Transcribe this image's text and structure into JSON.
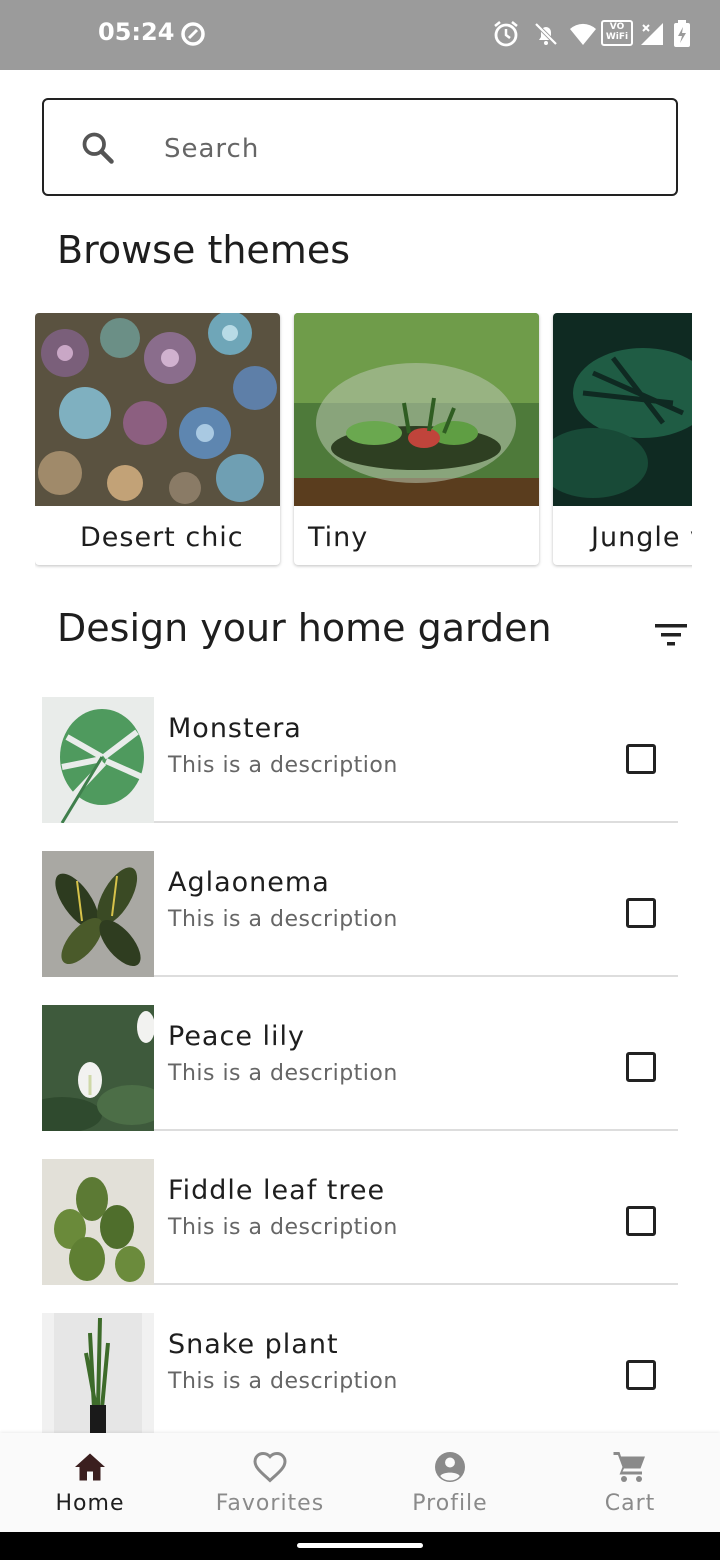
{
  "status_bar": {
    "time": "05:24",
    "icons": [
      "data-saver-icon",
      "alarm-icon",
      "bell-off-icon",
      "wifi-icon",
      "vowifi-icon",
      "signal-icon",
      "battery-charging-icon"
    ],
    "vowifi_text_top": "VO",
    "vowifi_text_bottom": "WiFi"
  },
  "search": {
    "placeholder": "Search",
    "icon": "search-icon"
  },
  "browse": {
    "title": "Browse themes",
    "themes": [
      {
        "label": "Desert chic",
        "icon": "succulents-image"
      },
      {
        "label": "Tiny",
        "icon": "terrarium-image"
      },
      {
        "label": "Jungle v",
        "icon": "monstera-leaves-image"
      }
    ]
  },
  "garden": {
    "title": "Design your home garden",
    "filter_icon": "filter-list-icon",
    "plants": [
      {
        "name": "Monstera",
        "description": "This is a description",
        "checked": false
      },
      {
        "name": "Aglaonema",
        "description": "This is a description",
        "checked": false
      },
      {
        "name": "Peace lily",
        "description": "This is a description",
        "checked": false
      },
      {
        "name": "Fiddle leaf tree",
        "description": "This is a description",
        "checked": false
      },
      {
        "name": "Snake plant",
        "description": "This is a description",
        "checked": false
      }
    ]
  },
  "bottom_nav": {
    "items": [
      {
        "label": "Home",
        "icon": "home-icon",
        "active": true
      },
      {
        "label": "Favorites",
        "icon": "heart-icon",
        "active": false
      },
      {
        "label": "Profile",
        "icon": "account-circle-icon",
        "active": false
      },
      {
        "label": "Cart",
        "icon": "cart-icon",
        "active": false
      }
    ]
  },
  "colors": {
    "status_bar": "#9b9b9b",
    "active_nav": "#1e1e1e",
    "inactive_nav": "#8a8a8a",
    "divider": "#dddddd"
  }
}
